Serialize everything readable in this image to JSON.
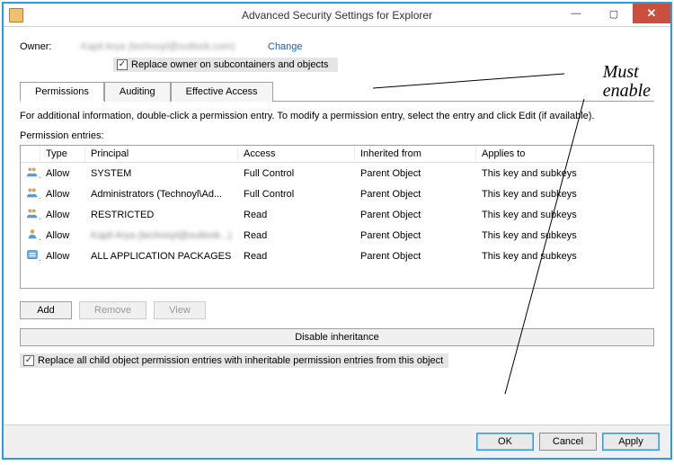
{
  "window": {
    "title": "Advanced Security Settings for Explorer"
  },
  "owner": {
    "label": "Owner:",
    "name": "Kapil Arya (technoyl@outlook.com)",
    "change": "Change",
    "replace_label": "Replace owner on subcontainers and objects",
    "replace_checked": true
  },
  "tabs": {
    "perm": "Permissions",
    "audit": "Auditing",
    "effective": "Effective Access"
  },
  "info": "For additional information, double-click a permission entry. To modify a permission entry, select the entry and click Edit (if available).",
  "entries_label": "Permission entries:",
  "columns": {
    "type": "Type",
    "principal": "Principal",
    "access": "Access",
    "inherited": "Inherited from",
    "applies": "Applies to"
  },
  "rows": [
    {
      "icon": "users",
      "type": "Allow",
      "principal": "SYSTEM",
      "access": "Full Control",
      "inherited": "Parent Object",
      "applies": "This key and subkeys"
    },
    {
      "icon": "users",
      "type": "Allow",
      "principal": "Administrators (Technoyl\\Ad...",
      "access": "Full Control",
      "inherited": "Parent Object",
      "applies": "This key and subkeys"
    },
    {
      "icon": "users",
      "type": "Allow",
      "principal": "RESTRICTED",
      "access": "Read",
      "inherited": "Parent Object",
      "applies": "This key and subkeys"
    },
    {
      "icon": "user",
      "type": "Allow",
      "principal": "Kapil Arya (technoyl@outlook...)",
      "blurred": true,
      "access": "Read",
      "inherited": "Parent Object",
      "applies": "This key and subkeys"
    },
    {
      "icon": "pkg",
      "type": "Allow",
      "principal": "ALL APPLICATION PACKAGES",
      "access": "Read",
      "inherited": "Parent Object",
      "applies": "This key and subkeys"
    }
  ],
  "buttons": {
    "add": "Add",
    "remove": "Remove",
    "view": "View",
    "disable_inherit": "Disable inheritance"
  },
  "replace_all": {
    "label": "Replace all child object permission entries with inheritable permission entries from this object",
    "checked": true
  },
  "footer": {
    "ok": "OK",
    "cancel": "Cancel",
    "apply": "Apply"
  },
  "annotation": {
    "line1": "Must",
    "line2": "enable"
  }
}
